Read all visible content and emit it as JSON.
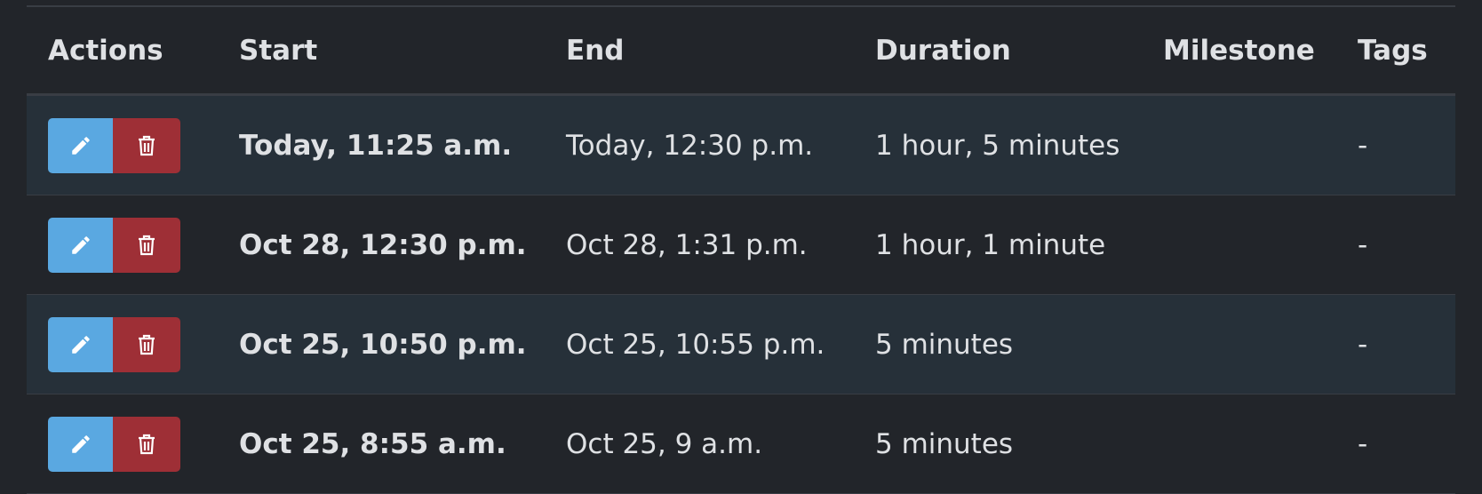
{
  "table": {
    "headers": {
      "actions": "Actions",
      "start": "Start",
      "end": "End",
      "duration": "Duration",
      "milestone": "Milestone",
      "tags": "Tags"
    },
    "rows": [
      {
        "start": "Today, 11:25 a.m.",
        "end": "Today, 12:30 p.m.",
        "duration": "1 hour, 5 minutes",
        "milestone": "",
        "tags": "-"
      },
      {
        "start": "Oct 28, 12:30 p.m.",
        "end": "Oct 28, 1:31 p.m.",
        "duration": "1 hour, 1 minute",
        "milestone": "",
        "tags": "-"
      },
      {
        "start": "Oct 25, 10:50 p.m.",
        "end": "Oct 25, 10:55 p.m.",
        "duration": "5 minutes",
        "milestone": "",
        "tags": "-"
      },
      {
        "start": "Oct 25, 8:55 a.m.",
        "end": "Oct 25, 9 a.m.",
        "duration": "5 minutes",
        "milestone": "",
        "tags": "-"
      }
    ]
  },
  "icons": {
    "edit": "pencil-icon",
    "delete": "trash-icon"
  },
  "colors": {
    "background": "#22252a",
    "stripe": "#263039",
    "border": "#393d44",
    "text": "#dfe1e4",
    "edit_button": "#5aa8e1",
    "delete_button": "#9e2f36"
  }
}
